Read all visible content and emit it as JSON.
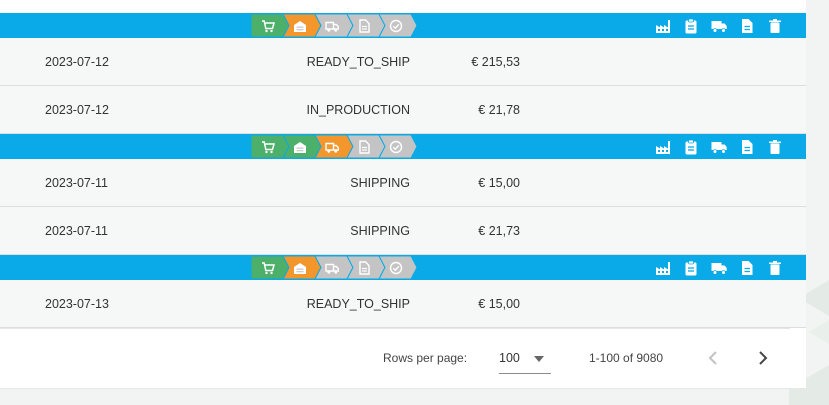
{
  "colors": {
    "bar": "#0aaae8",
    "step_done": "#4caf6a",
    "step_current": "#f3962b",
    "step_pending": "#c4c4c4",
    "row_bg": "#f5f8f7"
  },
  "workflow_steps": [
    "cart-icon",
    "warehouse-icon",
    "truck-icon",
    "document-icon",
    "check-circle-icon"
  ],
  "group_actions": [
    "factory-icon",
    "clipboard-icon",
    "truck-icon",
    "document-icon",
    "trash-icon"
  ],
  "groups": [
    {
      "steps_status": [
        "done",
        "current",
        "pending",
        "pending",
        "pending"
      ],
      "orders": [
        {
          "date": "2023-07-12",
          "status": "READY_TO_SHIP",
          "price": "€ 215,53"
        },
        {
          "date": "2023-07-12",
          "status": "IN_PRODUCTION",
          "price": "€ 21,78"
        }
      ]
    },
    {
      "steps_status": [
        "done",
        "done",
        "current",
        "pending",
        "pending"
      ],
      "orders": [
        {
          "date": "2023-07-11",
          "status": "SHIPPING",
          "price": "€ 15,00"
        },
        {
          "date": "2023-07-11",
          "status": "SHIPPING",
          "price": "€ 21,73"
        }
      ]
    },
    {
      "steps_status": [
        "done",
        "current",
        "pending",
        "pending",
        "pending"
      ],
      "orders": [
        {
          "date": "2023-07-13",
          "status": "READY_TO_SHIP",
          "price": "€ 15,00"
        }
      ]
    }
  ],
  "pagination": {
    "rows_per_page_label": "Rows per page:",
    "rows_per_page_value": "100",
    "range_text": "1-100 of 9080",
    "prev_icon": "chevron-left-icon",
    "next_icon": "chevron-right-icon"
  }
}
